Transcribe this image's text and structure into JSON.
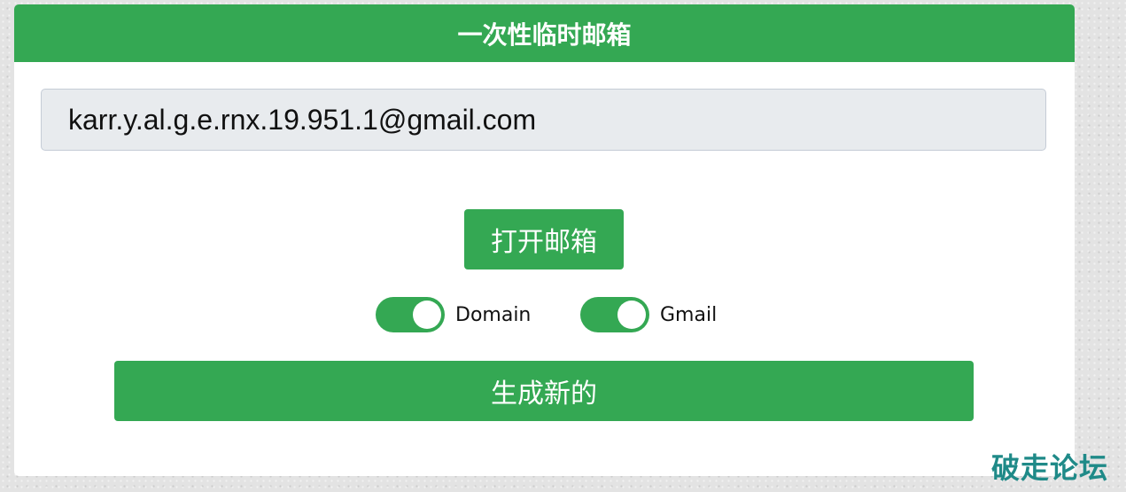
{
  "header": {
    "title": "一次性临时邮箱"
  },
  "email": {
    "value": "karr.y.al.g.e.rnx.19.951.1@gmail.com"
  },
  "buttons": {
    "open_label": "打开邮箱",
    "generate_label": "生成新的"
  },
  "toggles": [
    {
      "label": "Domain",
      "on": true
    },
    {
      "label": "Gmail",
      "on": true
    }
  ],
  "watermark": {
    "text": "破走论坛"
  },
  "colors": {
    "accent": "#34a853",
    "watermark": "#1f8a88",
    "field_bg": "#e8ebee"
  }
}
